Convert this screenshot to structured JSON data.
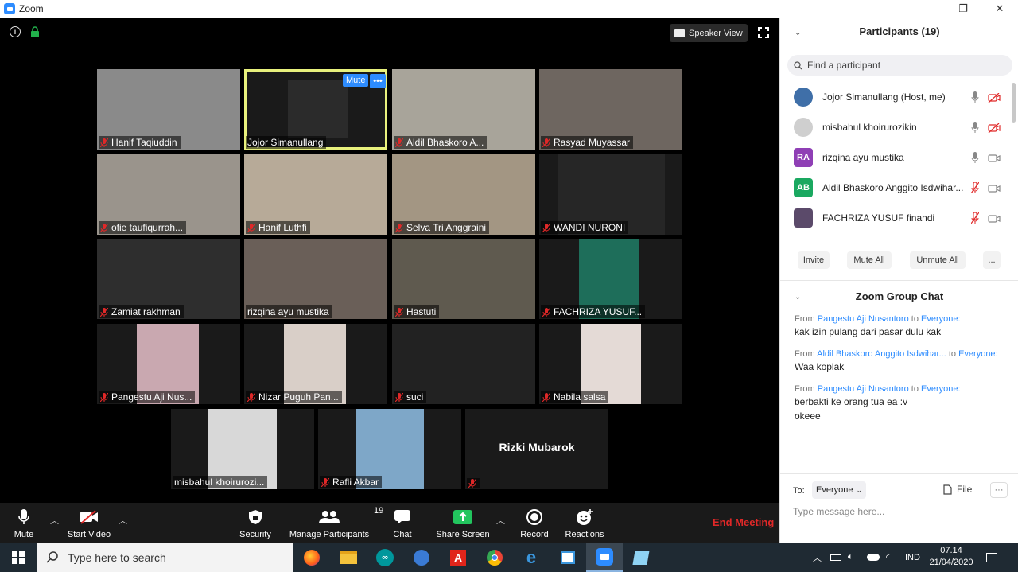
{
  "window": {
    "title": "Zoom"
  },
  "meeting": {
    "speaker_view_label": "Speaker View",
    "mute_label": "Mute",
    "more_label": "•••",
    "tiles": [
      {
        "name": "Hanif Taqiuddin",
        "bg": "#8a8a8a"
      },
      {
        "name": "Jojor Simanullang",
        "bg": "#2b2b2b"
      },
      {
        "name": "Aldil Bhaskoro A...",
        "bg": "#a8a49a"
      },
      {
        "name": "Rasyad Muyassar",
        "bg": "#6e6660"
      },
      {
        "name": "ofie taufiqurrah...",
        "bg": "#9a948c"
      },
      {
        "name": "Hanif Luthfi",
        "bg": "#b7aa98"
      },
      {
        "name": "Selva Tri Anggraini",
        "bg": "#a39683"
      },
      {
        "name": "WANDI NURONI",
        "bg": "#262626"
      },
      {
        "name": "Zamiat rakhman",
        "bg": "#2e2e2e"
      },
      {
        "name": "rizqina ayu mustika",
        "bg": "#6a5f58"
      },
      {
        "name": "Hastuti",
        "bg": "#5f5a4f"
      },
      {
        "name": "FACHRIZA YUSUF...",
        "bg": "#1e6e5a"
      },
      {
        "name": "Pangestu Aji Nus...",
        "bg": "#c9a8b0"
      },
      {
        "name": "Nizar Puguh Pan...",
        "bg": "#d9cfc8"
      },
      {
        "name": "suci",
        "bg": "#222222"
      },
      {
        "name": "Nabila salsa",
        "bg": "#e4dad6"
      },
      {
        "name": "misbahul khoirurozi...",
        "bg": "#d8d8d8"
      },
      {
        "name": "Rafli Akbar",
        "bg": "#7ea7c8"
      },
      {
        "name": "Rizki Mubarok",
        "bg": "#222222"
      }
    ]
  },
  "toolbar": {
    "mute": "Mute",
    "start_video": "Start Video",
    "security": "Security",
    "manage_participants": "Manage Participants",
    "participant_count": "19",
    "chat": "Chat",
    "share_screen": "Share Screen",
    "record": "Record",
    "reactions": "Reactions",
    "end_meeting": "End Meeting"
  },
  "participants_panel": {
    "title": "Participants (19)",
    "search_placeholder": "Find a participant",
    "items": [
      {
        "name": "Jojor Simanullang (Host, me)",
        "avatar": "",
        "avatar_color": "#3f6fa8"
      },
      {
        "name": "misbahul khoirurozikin",
        "avatar": "",
        "avatar_color": "#cfcfcf"
      },
      {
        "name": "rizqina ayu mustika",
        "avatar": "RA",
        "avatar_color": "#8f3fb5"
      },
      {
        "name": "Aldil Bhaskoro Anggito Isdwihar...",
        "avatar": "AB",
        "avatar_color": "#1aa860"
      },
      {
        "name": "FACHRIZA YUSUF finandi",
        "avatar": "",
        "avatar_color": "#5b4a6a"
      }
    ],
    "invite": "Invite",
    "mute_all": "Mute All",
    "unmute_all": "Unmute All",
    "more": "..."
  },
  "chat_panel": {
    "title": "Zoom Group Chat",
    "messages": [
      {
        "from_label": "From",
        "from": "Pangestu Aji Nusantoro",
        "to_label": "to",
        "to": "Everyone:",
        "text": [
          "kak izin pulang dari pasar dulu kak"
        ]
      },
      {
        "from_label": "From",
        "from": "Aldil Bhaskoro Anggito Isdwihar...",
        "to_label": "to",
        "to": "Everyone:",
        "text": [
          "Waa koplak"
        ]
      },
      {
        "from_label": "From",
        "from": "Pangestu Aji Nusantoro",
        "to_label": "to",
        "to": "Everyone:",
        "text": [
          "berbakti ke orang tua ea :v",
          "okeee"
        ]
      }
    ],
    "to_label": "To:",
    "to_value": "Everyone",
    "file_label": "File",
    "more": "···",
    "input_placeholder": "Type message here..."
  },
  "taskbar": {
    "search_placeholder": "Type here to search",
    "language": "IND",
    "time": "07.14",
    "date": "21/04/2020"
  }
}
